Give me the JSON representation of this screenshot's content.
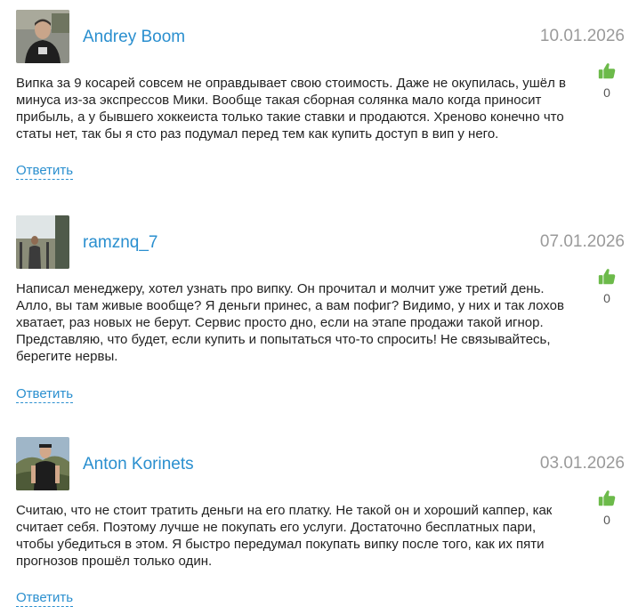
{
  "comments": [
    {
      "author": "Andrey Boom",
      "date": "10.01.2026",
      "text": "Випка за 9 косарей совсем не оправдывает свою стоимость. Даже не окупилась, ушёл в минуса из-за экспрессов Мики. Вообще такая сборная солянка мало когда приносит прибыль, а у бывшего хоккеиста только такие ставки и продаются. Хреново конечно что статы нет, так бы я сто раз подумал перед тем как купить доступ в вип у него.",
      "likes": "0",
      "reply_label": "Ответить"
    },
    {
      "author": "ramznq_7",
      "date": "07.01.2026",
      "text": "Написал менеджеру, хотел узнать про випку. Он прочитал и молчит уже третий день. Алло, вы там живые вообще? Я деньги принес, а вам пофиг? Видимо, у них и так лохов хватает, раз новых не берут. Сервис просто дно, если на этапе продажи такой игнор. Представляю, что будет, если купить и попытаться что-то спросить! Не связывайтесь, берегите нервы.",
      "likes": "0",
      "reply_label": "Ответить"
    },
    {
      "author": "Anton Korinets",
      "date": "03.01.2026",
      "text": "Считаю, что не стоит тратить деньги на его платку. Не такой он и хороший каппер, как считает себя. Поэтому лучше не покупать его услуги. Достаточно бесплатных пари, чтобы убедиться в этом. Я быстро передумал покупать випку после того, как их пяти прогнозов прошёл только один.",
      "likes": "0",
      "reply_label": "Ответить"
    }
  ],
  "colors": {
    "author_link": "#2a8fcf",
    "date": "#9a9a9a",
    "like_icon": "#6cba4a"
  },
  "icons": {
    "like": "thumbs-up-icon"
  }
}
